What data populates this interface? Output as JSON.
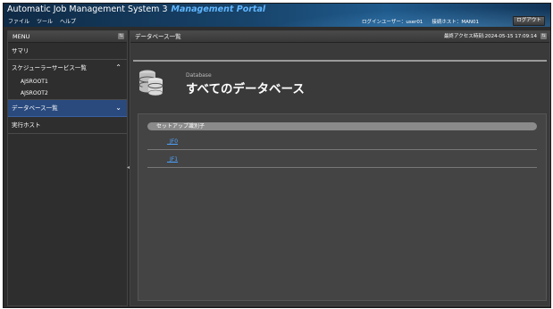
{
  "header": {
    "app_title": "Automatic Job Management System 3",
    "portal_title": "Management Portal",
    "menus": [
      "ファイル",
      "ツール",
      "ヘルプ"
    ],
    "login_user": "ログインユーザー：user01",
    "connected_host": "接続ホスト：MAN01",
    "logout_label": "ログアウト"
  },
  "sidebar": {
    "menu_label": "MENU",
    "items": {
      "summary": "サマリ",
      "scheduler": "スケジューラーサービス一覧",
      "sub1": "AJSROOT1",
      "sub2": "AJSROOT2",
      "database": "データベース一覧",
      "exec_host": "実行ホスト"
    }
  },
  "main": {
    "panel_title": "データベース一覧",
    "last_access": "最終アクセス時刻:2024-05-15 17:09:14",
    "caption": "Database",
    "title": "すべてのデータベース",
    "column_header": "セットアップ識別子",
    "rows": [
      "_JF0",
      "_JF1"
    ]
  },
  "colors": {
    "accent": "#5fb6ff",
    "active_item": "#2a4a7e",
    "link": "#4da3ff"
  }
}
